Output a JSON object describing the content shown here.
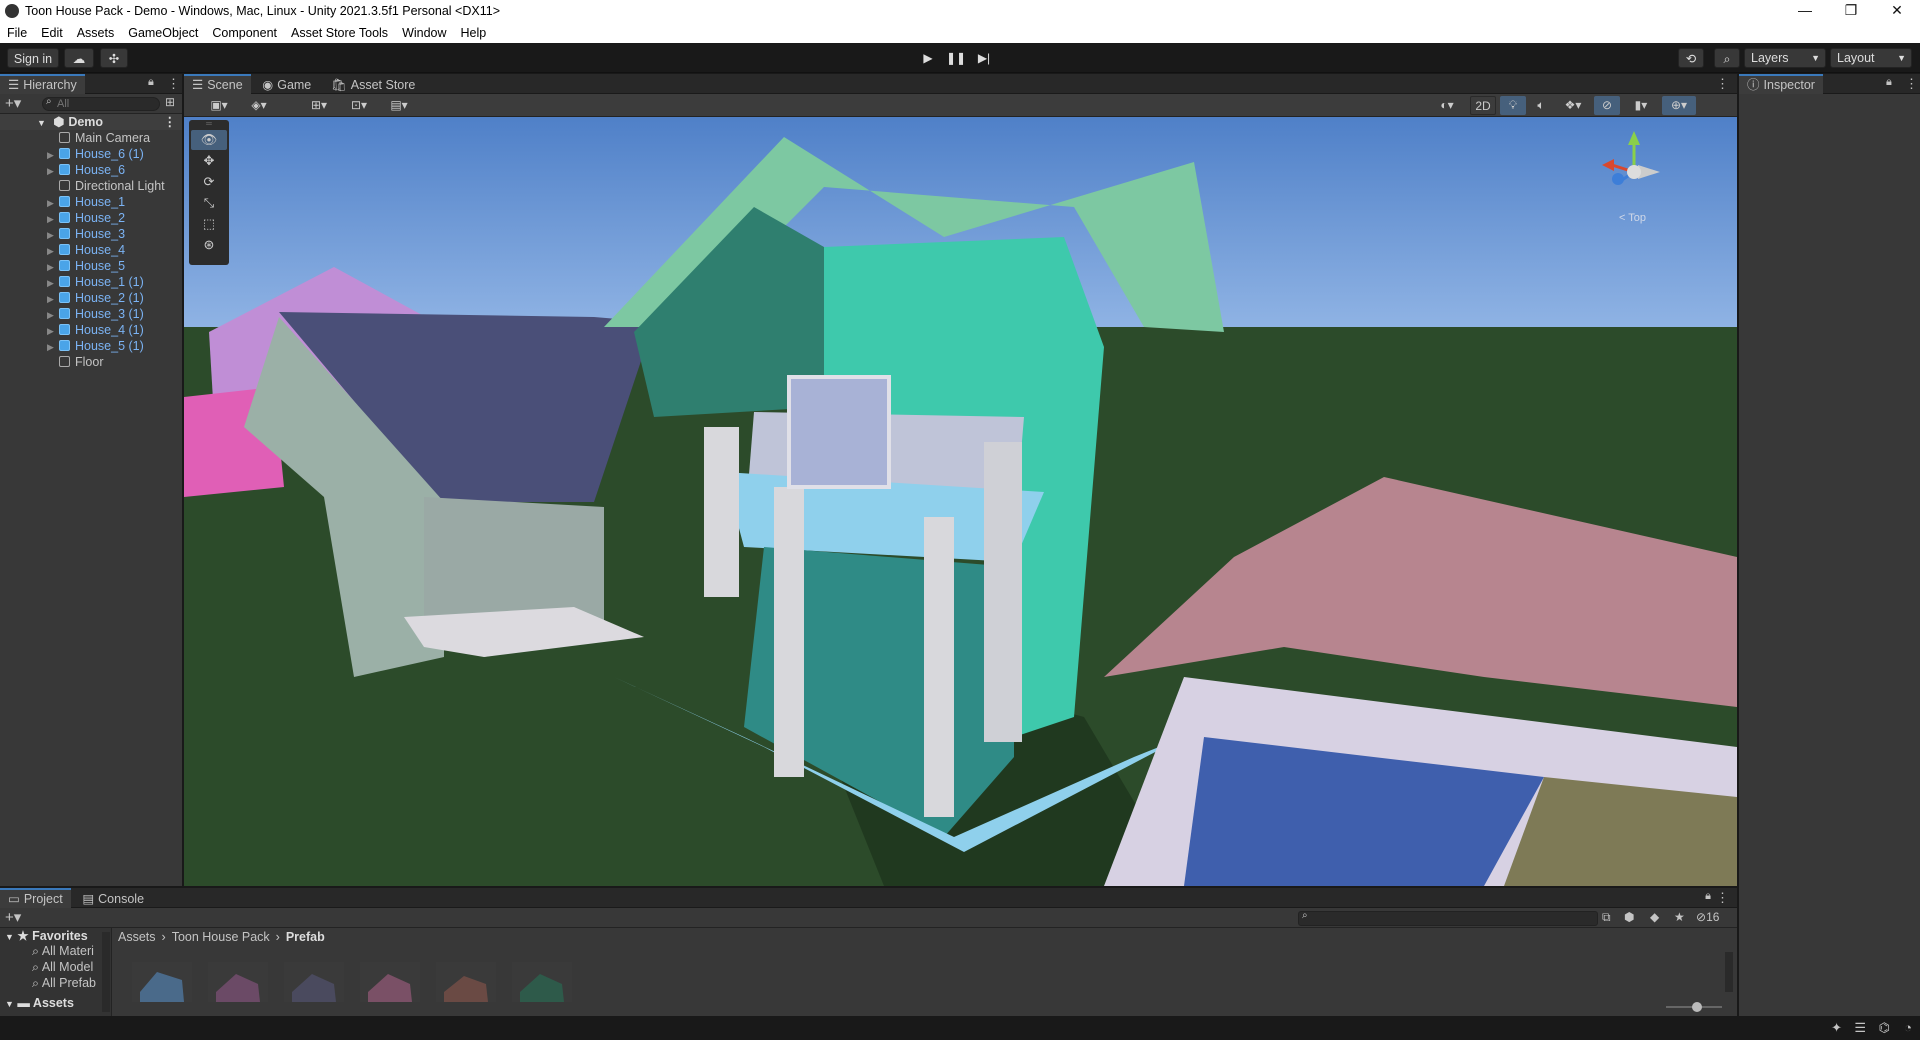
{
  "window": {
    "title": "Toon House Pack - Demo - Windows, Mac, Linux - Unity 2021.3.5f1 Personal <DX11>",
    "minimize": "—",
    "maximize": "❐",
    "close": "✕"
  },
  "menu": [
    "File",
    "Edit",
    "Assets",
    "GameObject",
    "Component",
    "Asset Store Tools",
    "Window",
    "Help"
  ],
  "toolbar": {
    "sign_in": "Sign in",
    "layers": "Layers",
    "layout": "Layout"
  },
  "hierarchy": {
    "tab": "Hierarchy",
    "search_placeholder": "All",
    "scene_name": "Demo",
    "items": [
      {
        "label": "Main Camera",
        "prefab": false
      },
      {
        "label": "House_6 (1)",
        "prefab": true
      },
      {
        "label": "House_6",
        "prefab": true
      },
      {
        "label": "Directional Light",
        "prefab": false
      },
      {
        "label": "House_1",
        "prefab": true
      },
      {
        "label": "House_2",
        "prefab": true
      },
      {
        "label": "House_3",
        "prefab": true
      },
      {
        "label": "House_4",
        "prefab": true
      },
      {
        "label": "House_5",
        "prefab": true
      },
      {
        "label": "House_1 (1)",
        "prefab": true
      },
      {
        "label": "House_2 (1)",
        "prefab": true
      },
      {
        "label": "House_3 (1)",
        "prefab": true
      },
      {
        "label": "House_4 (1)",
        "prefab": true
      },
      {
        "label": "House_5 (1)",
        "prefab": true
      },
      {
        "label": "Floor",
        "prefab": false
      }
    ]
  },
  "tabs": {
    "scene": "Scene",
    "game": "Game",
    "asset_store": "Asset Store",
    "inspector": "Inspector",
    "project": "Project",
    "console": "Console"
  },
  "scene_toolbar": {
    "mode_2d": "2D",
    "gizmo_label": "< Top"
  },
  "project": {
    "favorites_label": "Favorites",
    "favorites": [
      "All Materi",
      "All Model",
      "All Prefab"
    ],
    "assets_label": "Assets",
    "breadcrumb": [
      "Assets",
      "Toon House Pack",
      "Prefab"
    ],
    "hidden_count": "16"
  },
  "colors": {
    "accent": "#3a79bb",
    "prefab_text": "#7bb3f4",
    "panel": "#383838",
    "header": "#282828"
  }
}
